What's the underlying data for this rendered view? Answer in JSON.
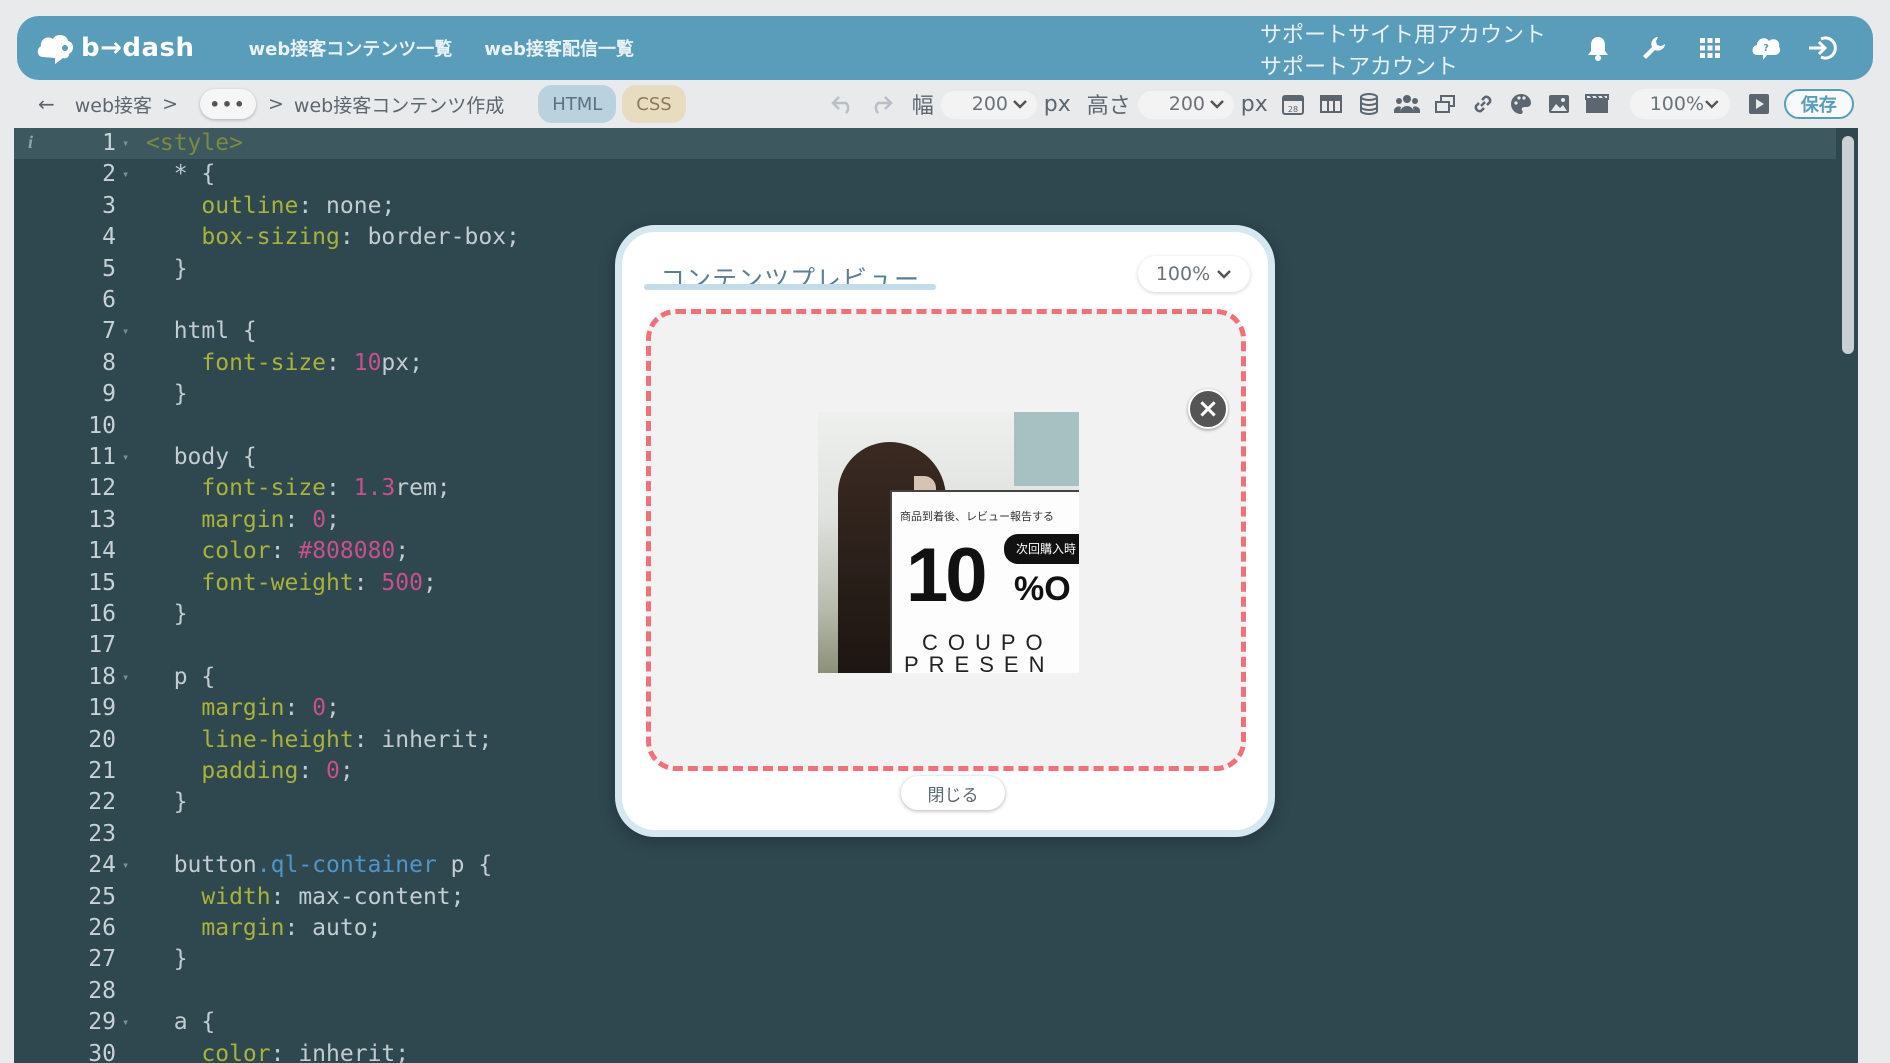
{
  "header": {
    "logo_text": "b→dash",
    "nav": [
      "web接客コンテンツ一覧",
      "web接客配信一覧"
    ],
    "account_line1": "サポートサイト用アカウント",
    "account_line2": "サポートアカウント",
    "icons": [
      "bell-icon",
      "wrench-icon",
      "grid-icon",
      "help-icon",
      "logout-icon"
    ]
  },
  "toolbar": {
    "back_arrow": "←",
    "crumb_root": "web接客",
    "crumb_sep1": ">",
    "more": "•••",
    "crumb_sep2": ">",
    "crumb_current": "web接客コンテンツ作成",
    "tab_html": "HTML",
    "tab_css": "CSS",
    "width_label": "幅",
    "width_value": "200",
    "px1": "px",
    "height_label": "高さ",
    "height_value": "200",
    "px2": "px",
    "zoom": "100%",
    "save": "保存"
  },
  "editor": {
    "lines": [
      {
        "n": "1",
        "text": "<style>"
      },
      {
        "n": "2",
        "text": "  * {"
      },
      {
        "n": "3",
        "text": "    outline: none;"
      },
      {
        "n": "4",
        "text": "    box-sizing: border-box;"
      },
      {
        "n": "5",
        "text": "  }"
      },
      {
        "n": "6",
        "text": ""
      },
      {
        "n": "7",
        "text": "  html {"
      },
      {
        "n": "8",
        "text": "    font-size: 10px;"
      },
      {
        "n": "9",
        "text": "  }"
      },
      {
        "n": "10",
        "text": ""
      },
      {
        "n": "11",
        "text": "  body {"
      },
      {
        "n": "12",
        "text": "    font-size: 1.3rem;"
      },
      {
        "n": "13",
        "text": "    margin: 0;"
      },
      {
        "n": "14",
        "text": "    color: #808080;"
      },
      {
        "n": "15",
        "text": "    font-weight: 500;"
      },
      {
        "n": "16",
        "text": "  }"
      },
      {
        "n": "17",
        "text": ""
      },
      {
        "n": "18",
        "text": "  p {"
      },
      {
        "n": "19",
        "text": "    margin: 0;"
      },
      {
        "n": "20",
        "text": "    line-height: inherit;"
      },
      {
        "n": "21",
        "text": "    padding: 0;"
      },
      {
        "n": "22",
        "text": "  }"
      },
      {
        "n": "23",
        "text": ""
      },
      {
        "n": "24",
        "text": "  button.ql-container p {"
      },
      {
        "n": "25",
        "text": "    width: max-content;"
      },
      {
        "n": "26",
        "text": "    margin: auto;"
      },
      {
        "n": "27",
        "text": "  }"
      },
      {
        "n": "28",
        "text": ""
      },
      {
        "n": "29",
        "text": "  a {"
      },
      {
        "n": "30",
        "text": "    color: inherit;"
      }
    ]
  },
  "modal": {
    "title": "コンテンツプレビュー",
    "zoom": "100%",
    "close_button": "閉じる",
    "close_icon": "×",
    "banner": {
      "small_text": "商品到着後、レビュー報告する",
      "pill_text": "次回購入時",
      "big_number": "10",
      "percent_text": "%O",
      "coupon_text": "COUPO",
      "present_text": "PRESEN"
    }
  },
  "colors": {
    "header_bg": "#5a9dbb",
    "editor_bg": "#2f474f",
    "preview_border": "#f2707a"
  }
}
